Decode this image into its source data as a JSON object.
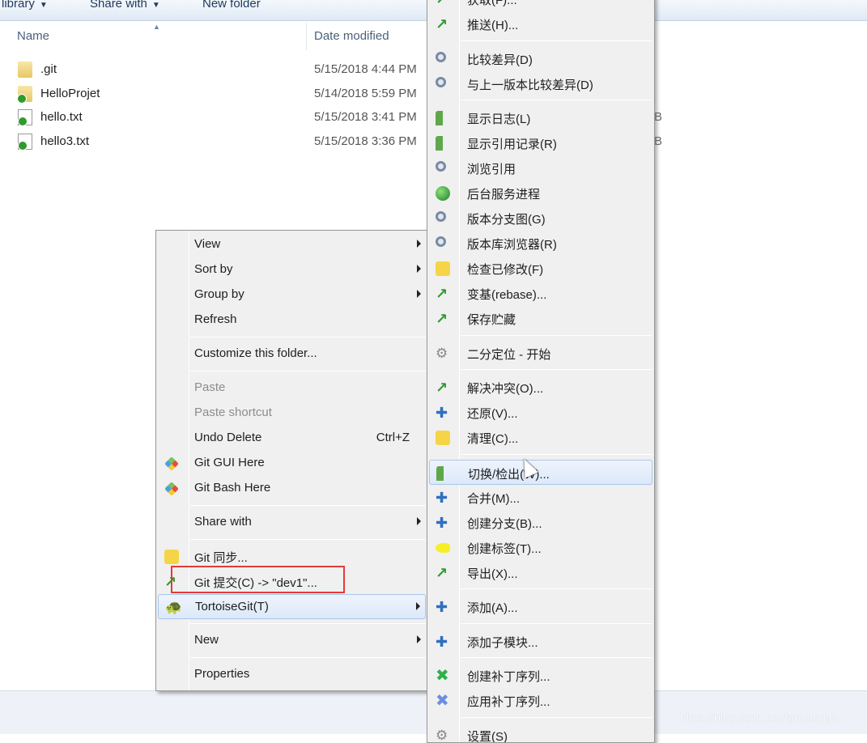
{
  "toolbar": {
    "items": [
      "library",
      "Share with",
      "New folder"
    ]
  },
  "columns": {
    "name": "Name",
    "date": "Date modified"
  },
  "files": [
    {
      "name": ".git",
      "date": "5/15/2018 4:44 PM",
      "icon": "folder-icon",
      "overlay": false
    },
    {
      "name": "HelloProjet",
      "date": "5/14/2018 5:59 PM",
      "icon": "folder-icon",
      "overlay": true
    },
    {
      "name": "hello.txt",
      "date": "5/15/2018 3:41 PM",
      "icon": "text-file-icon",
      "overlay": true,
      "size_suffix": "B"
    },
    {
      "name": "hello3.txt",
      "date": "5/15/2018 3:36 PM",
      "icon": "text-file-icon",
      "overlay": true,
      "size_suffix": "B"
    }
  ],
  "context_menu": [
    {
      "label": "View",
      "submenu": true
    },
    {
      "label": "Sort by",
      "submenu": true
    },
    {
      "label": "Group by",
      "submenu": true
    },
    {
      "label": "Refresh"
    },
    {
      "sep": true
    },
    {
      "label": "Customize this folder..."
    },
    {
      "sep": true
    },
    {
      "label": "Paste",
      "disabled": true
    },
    {
      "label": "Paste shortcut",
      "disabled": true
    },
    {
      "label": "Undo Delete",
      "shortcut": "Ctrl+Z"
    },
    {
      "label": "Git GUI Here",
      "icon": "git-gui-icon"
    },
    {
      "label": "Git Bash Here",
      "icon": "git-bash-icon"
    },
    {
      "sep": true
    },
    {
      "label": "Share with",
      "submenu": true
    },
    {
      "sep": true
    },
    {
      "label": "Git 同步...",
      "icon": "git-sync-icon"
    },
    {
      "label": "Git 提交(C) -> \"dev1\"...",
      "icon": "git-commit-icon"
    },
    {
      "label": "TortoiseGit(T)",
      "icon": "tortoisegit-icon",
      "submenu": true,
      "highlighted": true
    },
    {
      "sep": true
    },
    {
      "label": "New",
      "submenu": true
    },
    {
      "sep": true
    },
    {
      "label": "Properties"
    }
  ],
  "tortoise_submenu": [
    {
      "label": "获取(F)...",
      "icon": "fetch-icon"
    },
    {
      "label": "推送(H)...",
      "icon": "push-icon"
    },
    {
      "sep": true
    },
    {
      "label": "比较差异(D)",
      "icon": "diff-icon"
    },
    {
      "label": "与上一版本比较差异(D)",
      "icon": "diff-prev-icon"
    },
    {
      "sep": true
    },
    {
      "label": "显示日志(L)",
      "icon": "show-log-icon"
    },
    {
      "label": "显示引用记录(R)",
      "icon": "reflog-icon"
    },
    {
      "label": "浏览引用",
      "icon": "browse-refs-icon"
    },
    {
      "label": "后台服务进程",
      "icon": "daemon-icon"
    },
    {
      "label": "版本分支图(G)",
      "icon": "revision-graph-icon"
    },
    {
      "label": "版本库浏览器(R)",
      "icon": "repo-browser-icon"
    },
    {
      "label": "检查已修改(F)",
      "icon": "check-modifications-icon"
    },
    {
      "label": "变基(rebase)...",
      "icon": "rebase-icon"
    },
    {
      "label": "保存贮藏",
      "icon": "stash-save-icon"
    },
    {
      "sep": true
    },
    {
      "label": "二分定位 - 开始",
      "icon": "bisect-icon"
    },
    {
      "sep": true
    },
    {
      "label": "解决冲突(O)...",
      "icon": "resolve-icon"
    },
    {
      "label": "还原(V)...",
      "icon": "revert-icon"
    },
    {
      "label": "清理(C)...",
      "icon": "cleanup-icon"
    },
    {
      "sep": true
    },
    {
      "label": "切换/检出(W)...",
      "icon": "switch-checkout-icon",
      "highlighted": true
    },
    {
      "label": "合并(M)...",
      "icon": "merge-icon"
    },
    {
      "label": "创建分支(B)...",
      "icon": "create-branch-icon"
    },
    {
      "label": "创建标签(T)...",
      "icon": "create-tag-icon"
    },
    {
      "label": "导出(X)...",
      "icon": "export-icon"
    },
    {
      "sep": true
    },
    {
      "label": "添加(A)...",
      "icon": "add-icon"
    },
    {
      "sep": true
    },
    {
      "label": "添加子模块...",
      "icon": "add-submodule-icon"
    },
    {
      "sep": true
    },
    {
      "label": "创建补丁序列...",
      "icon": "create-patch-icon"
    },
    {
      "label": "应用补丁序列...",
      "icon": "apply-patch-icon"
    },
    {
      "sep": true
    },
    {
      "label": "设置(S)",
      "icon": "settings-icon"
    }
  ],
  "watermark": "https://blog.csdn.net/fanbaodan",
  "colors": {
    "highlight_border": "#a9c6ec",
    "annotation_box": "#e33a3a"
  }
}
